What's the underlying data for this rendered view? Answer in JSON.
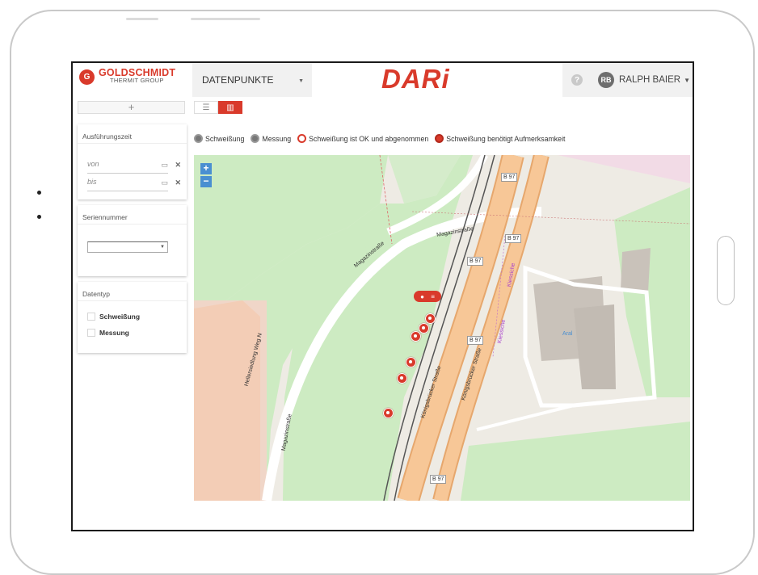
{
  "header": {
    "logo_mark": "G",
    "logo_name": "GOLDSCHMIDT",
    "logo_sub": "THERMIT GROUP",
    "module": "DATENPUNKTE",
    "brand": "DARi",
    "help": "?",
    "user_initials": "RB",
    "user_name": "RALPH BAIER"
  },
  "sidebar": {
    "add_label": "+",
    "execution": {
      "title": "Ausführungszeit",
      "from_placeholder": "von",
      "to_placeholder": "bis"
    },
    "serial": {
      "title": "Seriennummer",
      "value": ""
    },
    "datatype": {
      "title": "Datentyp",
      "options": [
        "Schweißung",
        "Messung"
      ]
    }
  },
  "legend": {
    "items": [
      "Schweißung",
      "Messung",
      "Schweißung ist OK und abgenommen",
      "Schweißung benötigt Aufmerksamkeit"
    ]
  },
  "map": {
    "zoom_in": "+",
    "zoom_out": "−",
    "labels": {
      "magazin1": "Magazinstraße",
      "magazin2": "Magazinstraße",
      "magazin3": "Magazinstraße",
      "hellersiedlung": "Hellersiedlung Weg N",
      "koenig1": "Königsbrücker Straße",
      "koenig2": "Königsbrücker Straße",
      "kiessiche1": "Kiessiche",
      "kiessiche2": "Kiessiche",
      "aral": "Aral"
    },
    "shields": [
      "B 97",
      "B 97",
      "B 97",
      "B 97",
      "B 97"
    ]
  }
}
